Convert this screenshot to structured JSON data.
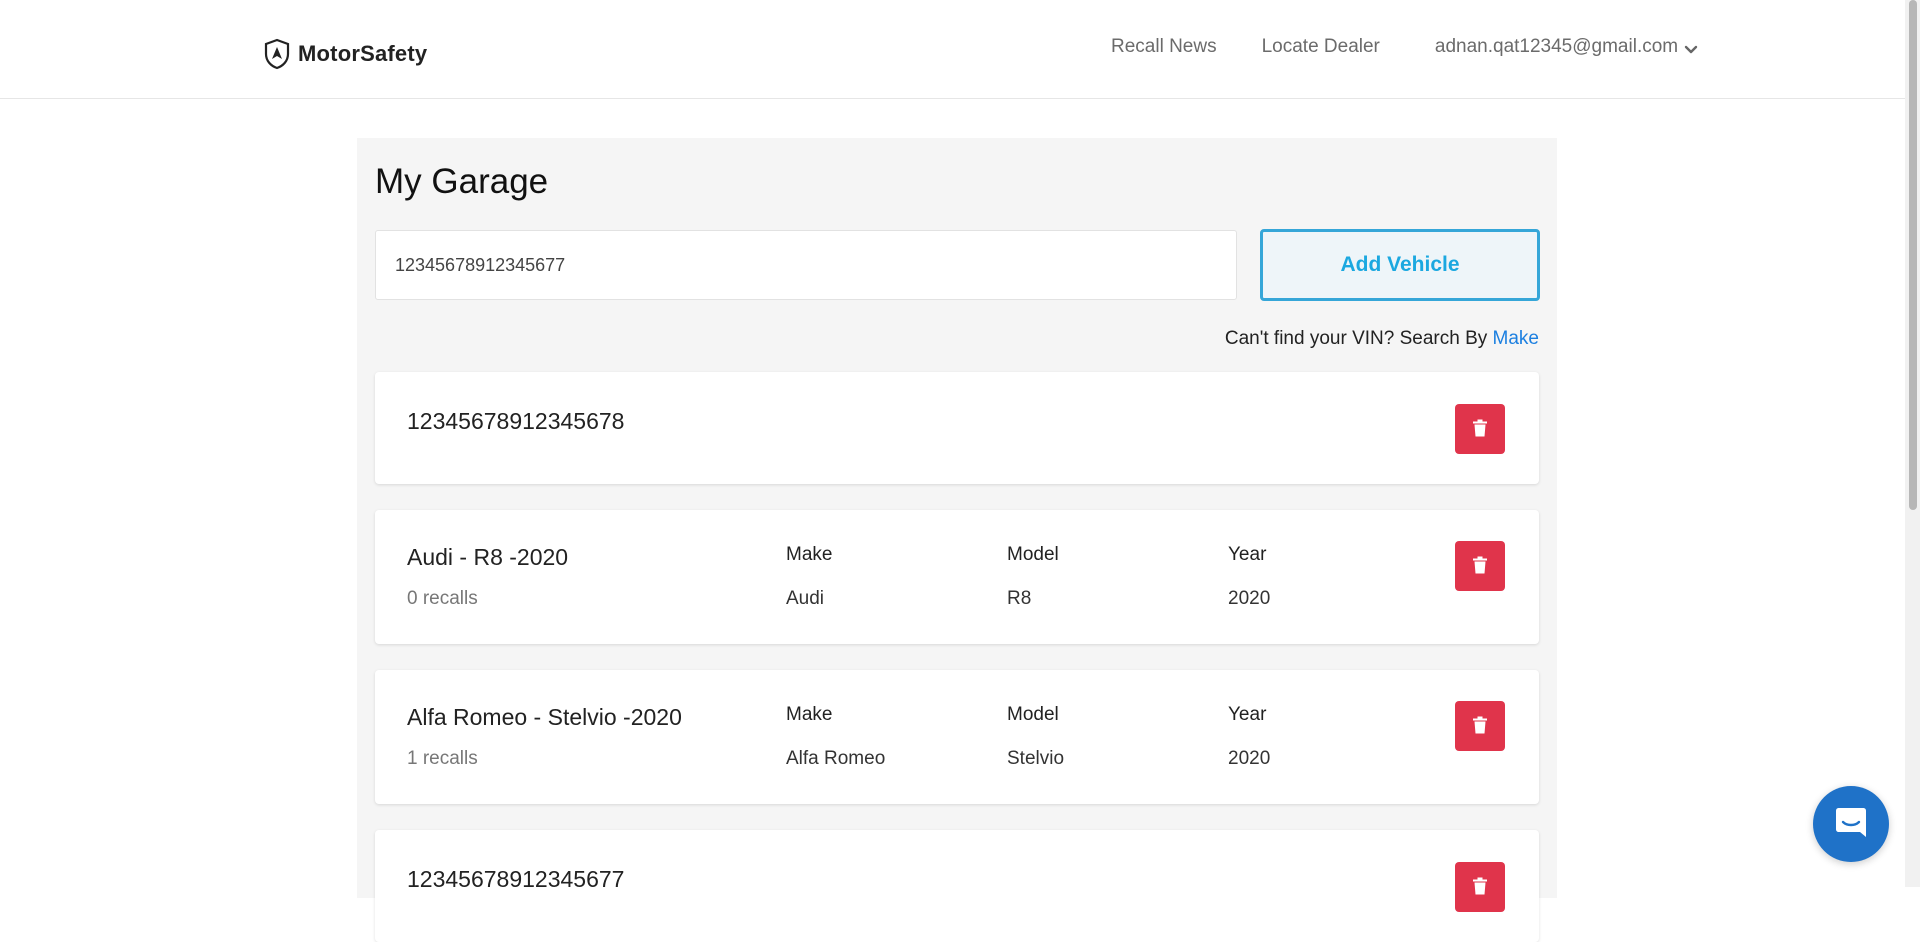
{
  "header": {
    "brand": "MotorSafety",
    "nav": {
      "recall_news": "Recall News",
      "locate_dealer": "Locate Dealer",
      "user_email": "adnan.qat12345@gmail.com"
    }
  },
  "garage": {
    "title": "My Garage",
    "vin_input_value": "12345678912345677",
    "add_button": "Add Vehicle",
    "search_hint_prefix": "Can't find your VIN? Search By",
    "search_hint_link": "Make"
  },
  "vehicles": [
    {
      "title": "12345678912345678"
    },
    {
      "title": "Audi - R8 -2020",
      "recalls": "0 recalls",
      "make_label": "Make",
      "make": "Audi",
      "model_label": "Model",
      "model": "R8",
      "year_label": "Year",
      "year": "2020"
    },
    {
      "title": "Alfa Romeo - Stelvio -2020",
      "recalls": "1 recalls",
      "make_label": "Make",
      "make": "Alfa Romeo",
      "model_label": "Model",
      "model": "Stelvio",
      "year_label": "Year",
      "year": "2020"
    },
    {
      "title": "12345678912345677"
    }
  ],
  "colors": {
    "accent": "#1ba8e0",
    "link": "#1b7fe0",
    "delete": "#e0344b",
    "chat": "#1f72c8"
  },
  "icons": {
    "brand": "shield-arrow-icon",
    "user_menu": "chevron-down-icon",
    "delete": "trash-icon",
    "chat": "chat-icon"
  }
}
